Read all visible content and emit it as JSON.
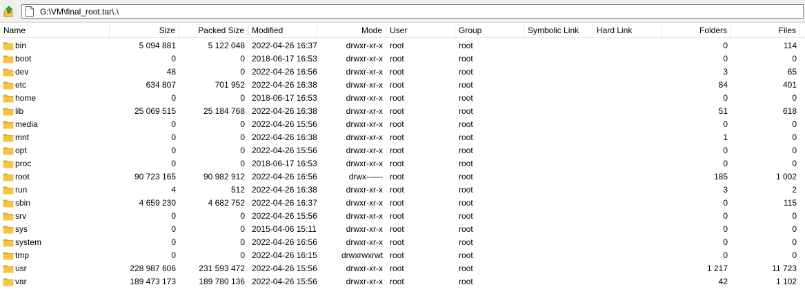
{
  "address": {
    "path": "G:\\VM\\final_root.tar\\.\\"
  },
  "columns": {
    "name": "Name",
    "size": "Size",
    "packed": "Packed Size",
    "modified": "Modified",
    "mode": "Mode",
    "user": "User",
    "group": "Group",
    "symlink": "Symbolic Link",
    "hardlink": "Hard Link",
    "folders": "Folders",
    "files": "Files"
  },
  "rows": [
    {
      "name": "bin",
      "size": "5 094 881",
      "packed": "5 122 048",
      "modified": "2022-04-26 16:37",
      "mode": "drwxr-xr-x",
      "user": "root",
      "group": "root",
      "folders": "0",
      "files": "114"
    },
    {
      "name": "boot",
      "size": "0",
      "packed": "0",
      "modified": "2018-06-17 16:53",
      "mode": "drwxr-xr-x",
      "user": "root",
      "group": "root",
      "folders": "0",
      "files": "0"
    },
    {
      "name": "dev",
      "size": "48",
      "packed": "0",
      "modified": "2022-04-26 16:56",
      "mode": "drwxr-xr-x",
      "user": "root",
      "group": "root",
      "folders": "3",
      "files": "65"
    },
    {
      "name": "etc",
      "size": "634 807",
      "packed": "701 952",
      "modified": "2022-04-26 16:38",
      "mode": "drwxr-xr-x",
      "user": "root",
      "group": "root",
      "folders": "84",
      "files": "401"
    },
    {
      "name": "home",
      "size": "0",
      "packed": "0",
      "modified": "2018-06-17 16:53",
      "mode": "drwxr-xr-x",
      "user": "root",
      "group": "root",
      "folders": "0",
      "files": "0"
    },
    {
      "name": "lib",
      "size": "25 069 515",
      "packed": "25 184 768",
      "modified": "2022-04-26 16:38",
      "mode": "drwxr-xr-x",
      "user": "root",
      "group": "root",
      "folders": "51",
      "files": "618"
    },
    {
      "name": "media",
      "size": "0",
      "packed": "0",
      "modified": "2022-04-26 15:56",
      "mode": "drwxr-xr-x",
      "user": "root",
      "group": "root",
      "folders": "0",
      "files": "0"
    },
    {
      "name": "mnt",
      "size": "0",
      "packed": "0",
      "modified": "2022-04-26 16:38",
      "mode": "drwxr-xr-x",
      "user": "root",
      "group": "root",
      "folders": "1",
      "files": "0"
    },
    {
      "name": "opt",
      "size": "0",
      "packed": "0",
      "modified": "2022-04-26 15:56",
      "mode": "drwxr-xr-x",
      "user": "root",
      "group": "root",
      "folders": "0",
      "files": "0"
    },
    {
      "name": "proc",
      "size": "0",
      "packed": "0",
      "modified": "2018-06-17 16:53",
      "mode": "drwxr-xr-x",
      "user": "root",
      "group": "root",
      "folders": "0",
      "files": "0"
    },
    {
      "name": "root",
      "size": "90 723 165",
      "packed": "90 982 912",
      "modified": "2022-04-26 16:56",
      "mode": "drwx------",
      "user": "root",
      "group": "root",
      "folders": "185",
      "files": "1 002"
    },
    {
      "name": "run",
      "size": "4",
      "packed": "512",
      "modified": "2022-04-26 16:38",
      "mode": "drwxr-xr-x",
      "user": "root",
      "group": "root",
      "folders": "3",
      "files": "2"
    },
    {
      "name": "sbin",
      "size": "4 659 230",
      "packed": "4 682 752",
      "modified": "2022-04-26 16:37",
      "mode": "drwxr-xr-x",
      "user": "root",
      "group": "root",
      "folders": "0",
      "files": "115"
    },
    {
      "name": "srv",
      "size": "0",
      "packed": "0",
      "modified": "2022-04-26 15:56",
      "mode": "drwxr-xr-x",
      "user": "root",
      "group": "root",
      "folders": "0",
      "files": "0"
    },
    {
      "name": "sys",
      "size": "0",
      "packed": "0",
      "modified": "2015-04-06 15:11",
      "mode": "drwxr-xr-x",
      "user": "root",
      "group": "root",
      "folders": "0",
      "files": "0"
    },
    {
      "name": "system",
      "size": "0",
      "packed": "0",
      "modified": "2022-04-26 16:56",
      "mode": "drwxr-xr-x",
      "user": "root",
      "group": "root",
      "folders": "0",
      "files": "0"
    },
    {
      "name": "tmp",
      "size": "0",
      "packed": "0",
      "modified": "2022-04-26 16:15",
      "mode": "drwxrwxrwt",
      "user": "root",
      "group": "root",
      "folders": "0",
      "files": "0"
    },
    {
      "name": "usr",
      "size": "228 987 606",
      "packed": "231 593 472",
      "modified": "2022-04-26 15:56",
      "mode": "drwxr-xr-x",
      "user": "root",
      "group": "root",
      "folders": "1 217",
      "files": "11 723"
    },
    {
      "name": "var",
      "size": "189 473 173",
      "packed": "189 780 136",
      "modified": "2022-04-26 15:56",
      "mode": "drwxr-xr-x",
      "user": "root",
      "group": "root",
      "folders": "42",
      "files": "1 102"
    }
  ],
  "icons": {
    "up": "up-folder-arrow-icon",
    "path": "document-icon",
    "folder": "folder-icon"
  },
  "colors": {
    "folder": "#f5c542",
    "folder_dark": "#dca72a",
    "arrow": "#3aa53a"
  }
}
